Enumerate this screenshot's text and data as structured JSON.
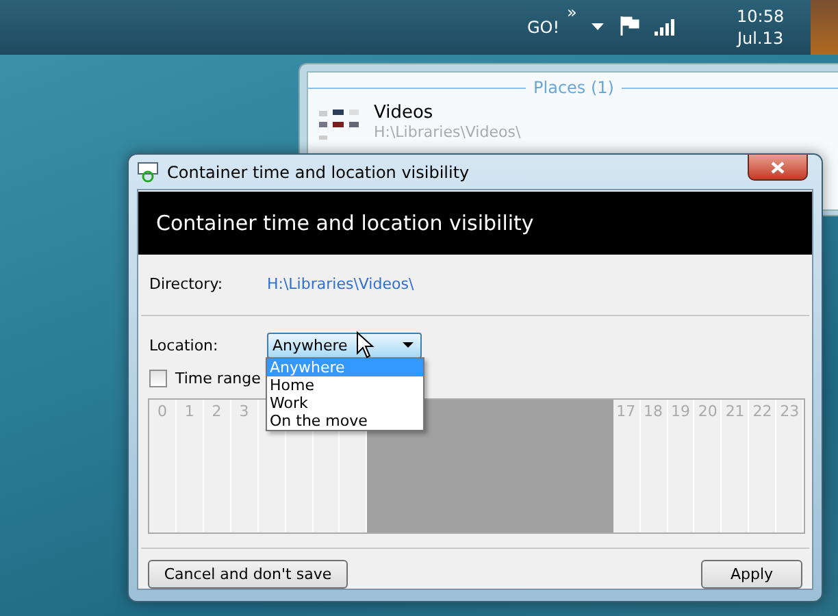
{
  "taskbar": {
    "go": "GO!",
    "chevron": "»",
    "time": "10:58",
    "date": "Jul.13"
  },
  "places_window": {
    "header": "Places (1)",
    "item": {
      "name": "Videos",
      "path": "H:\\Libraries\\Videos\\"
    }
  },
  "dialog": {
    "title": "Container time and location visibility",
    "heading": "Container time and location visibility",
    "directory": {
      "label": "Directory:",
      "value": "H:\\Libraries\\Videos\\"
    },
    "location": {
      "label": "Location:",
      "value": "Anywhere",
      "expanded": true,
      "options": [
        {
          "label": "Anywhere",
          "selected": true
        },
        {
          "label": "Home",
          "selected": false
        },
        {
          "label": "Work",
          "selected": false
        },
        {
          "label": "On the move",
          "selected": false
        }
      ]
    },
    "time_range": {
      "label": "Time range",
      "checked": false
    },
    "hours": [
      {
        "label": "0",
        "selected": false
      },
      {
        "label": "1",
        "selected": false
      },
      {
        "label": "2",
        "selected": false
      },
      {
        "label": "3",
        "selected": false
      },
      {
        "selected": false
      },
      {
        "selected": false
      },
      {
        "selected": false
      },
      {
        "selected": false
      },
      {
        "selected": true
      },
      {
        "selected": true
      },
      {
        "selected": true
      },
      {
        "selected": true
      },
      {
        "selected": true
      },
      {
        "selected": true
      },
      {
        "selected": true
      },
      {
        "selected": true
      },
      {
        "selected": true
      },
      {
        "label": "17",
        "selected": false
      },
      {
        "label": "18",
        "selected": false
      },
      {
        "label": "19",
        "selected": false
      },
      {
        "label": "20",
        "selected": false
      },
      {
        "label": "21",
        "selected": false
      },
      {
        "label": "22",
        "selected": false
      },
      {
        "label": "23",
        "selected": false
      }
    ],
    "buttons": [
      {
        "label": "Cancel and don't save"
      },
      {
        "label": "Apply"
      }
    ]
  }
}
